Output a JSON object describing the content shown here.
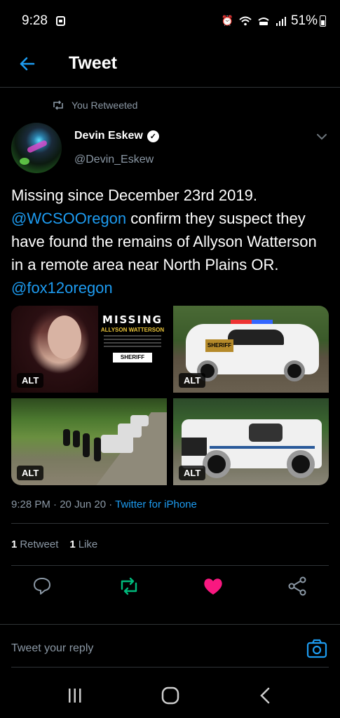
{
  "status": {
    "time": "9:28",
    "battery": "51%"
  },
  "header": {
    "title": "Tweet"
  },
  "retweet": {
    "label": "You Retweeted"
  },
  "author": {
    "name": "Devin Eskew",
    "handle": "@Devin_Eskew"
  },
  "tweet": {
    "part1": "Missing since December 23rd 2019. ",
    "mention1": "@WCSOOregon",
    "part2": " confirm they suspect they have found the remains of Allyson Watterson  in a remote area near North Plains OR.  ",
    "mention2": "@fox12oregon"
  },
  "media": {
    "alt_label": "ALT",
    "poster": {
      "title": "MISSING",
      "name": "ALLYSON WATTERSON",
      "footer": "SHERIFF"
    },
    "car_badge": "SHERIFF"
  },
  "meta": {
    "time": "9:28 PM",
    "dot1": " · ",
    "date": "20 Jun 20",
    "dot2": " · ",
    "app": "Twitter for iPhone"
  },
  "stats": {
    "retweets_count": "1",
    "retweets_label": "Retweet",
    "likes_count": "1",
    "likes_label": "Like"
  },
  "colors": {
    "accent": "#1d9bf0",
    "retweet_green": "#00ba7c",
    "like_pink": "#f91880"
  },
  "reply": {
    "placeholder": "Tweet your reply"
  }
}
